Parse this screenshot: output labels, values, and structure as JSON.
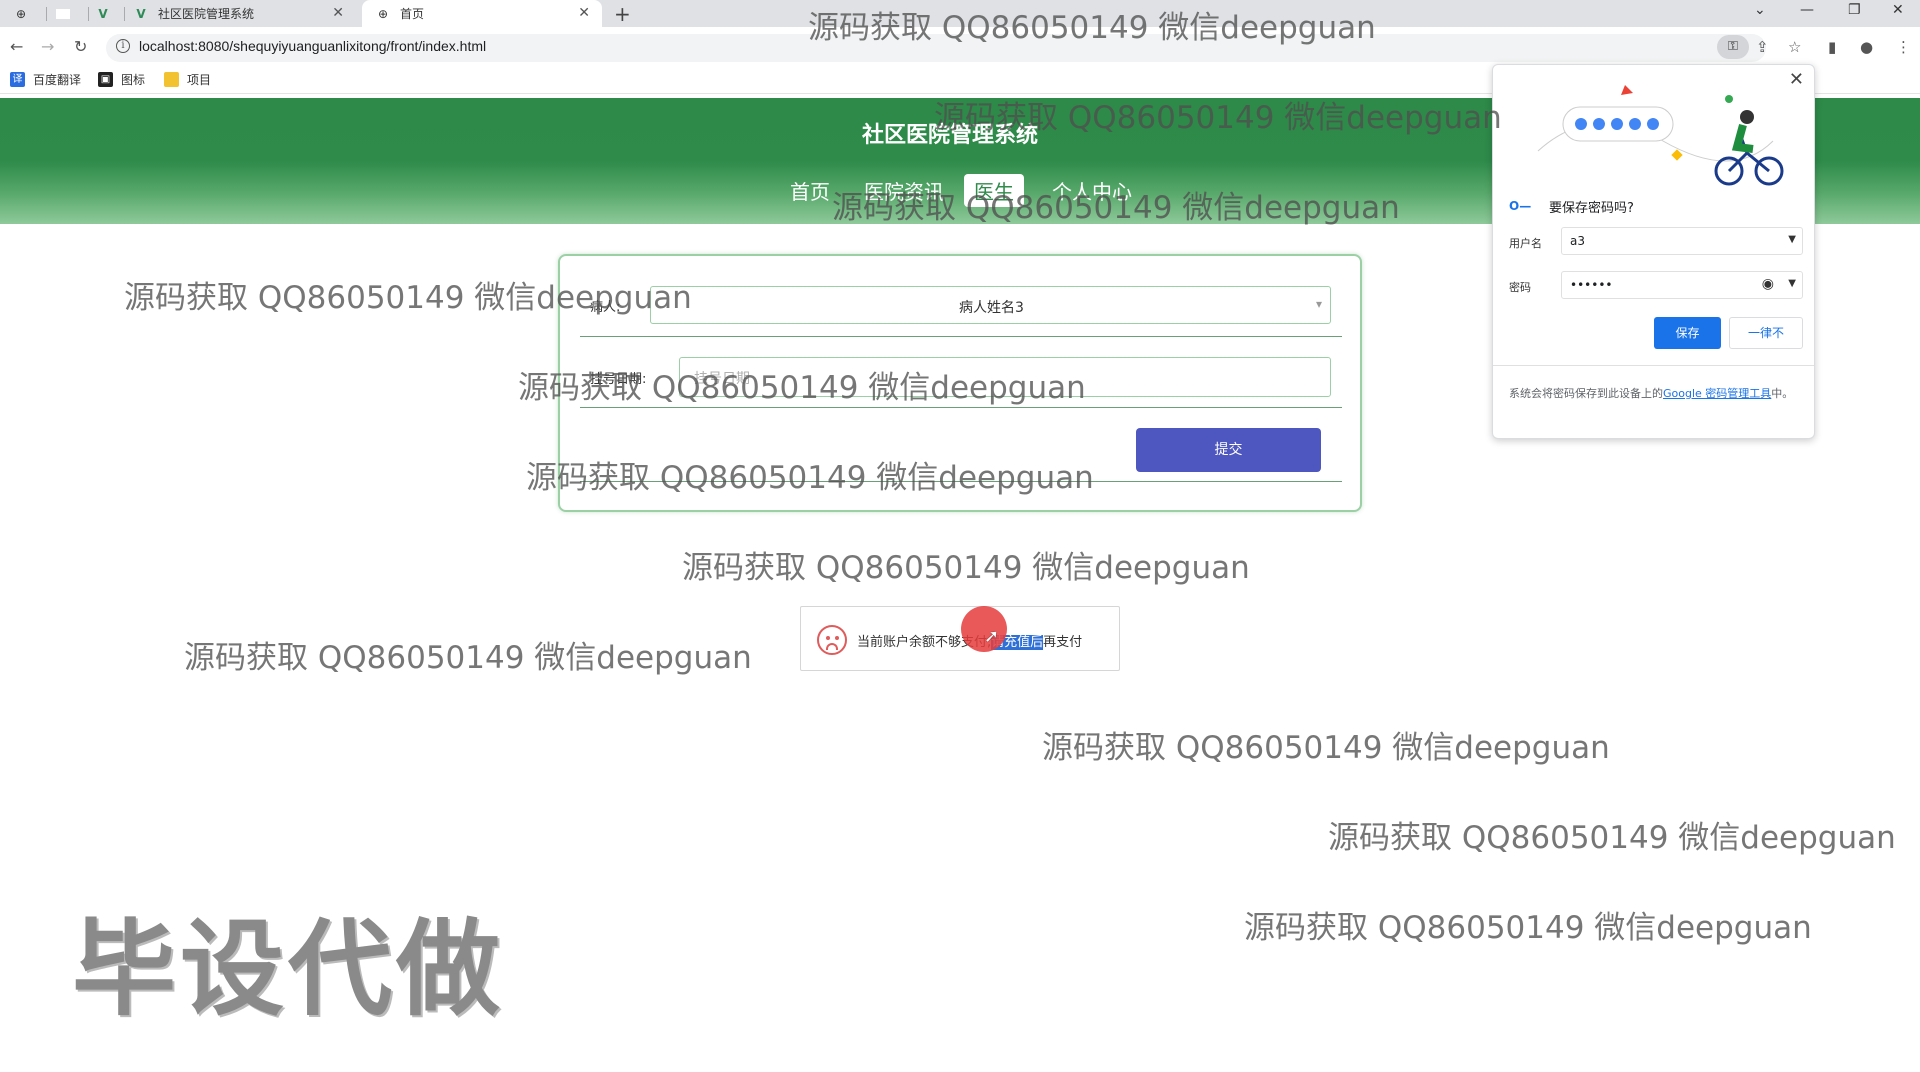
{
  "browser": {
    "tabs": [
      {
        "label": "",
        "icon": "globe-icon"
      },
      {
        "label": "",
        "icon": "blank-icon"
      },
      {
        "label": "",
        "icon": "vue-icon"
      },
      {
        "label": "社区医院管理系统",
        "icon": "vue-icon"
      },
      {
        "label": "首页",
        "icon": "globe-icon"
      }
    ],
    "url": "localhost:8080/shequyiyuanguanlixitong/front/index.html",
    "bookmarks": [
      "百度翻译",
      "图标",
      "项目"
    ]
  },
  "site": {
    "title": "社区医院管理系统",
    "nav": [
      "首页",
      "医院资讯",
      "医生",
      "个人中心"
    ],
    "active_nav": "医生"
  },
  "form": {
    "patient_label": "病人:",
    "patient_value": "病人姓名3",
    "date_label": "挂号日期:",
    "date_placeholder": "挂号日期",
    "submit_label": "提交"
  },
  "toast": {
    "text_before": "当前账户余额不够支付,",
    "text_highlight": "请充值后",
    "text_after": "再支付"
  },
  "password_popup": {
    "title": "要保存密码吗?",
    "username_label": "用户名",
    "username_value": "a3",
    "password_label": "密码",
    "password_value": "••••••",
    "save_label": "保存",
    "never_label": "一律不",
    "footer_text": "系统会将密码保存到此设备上的",
    "footer_link": "Google 密码管理工具",
    "footer_end": "中。"
  },
  "watermarks": {
    "text": "源码获取 QQ86050149 微信deepguan",
    "big": "毕设代做"
  }
}
